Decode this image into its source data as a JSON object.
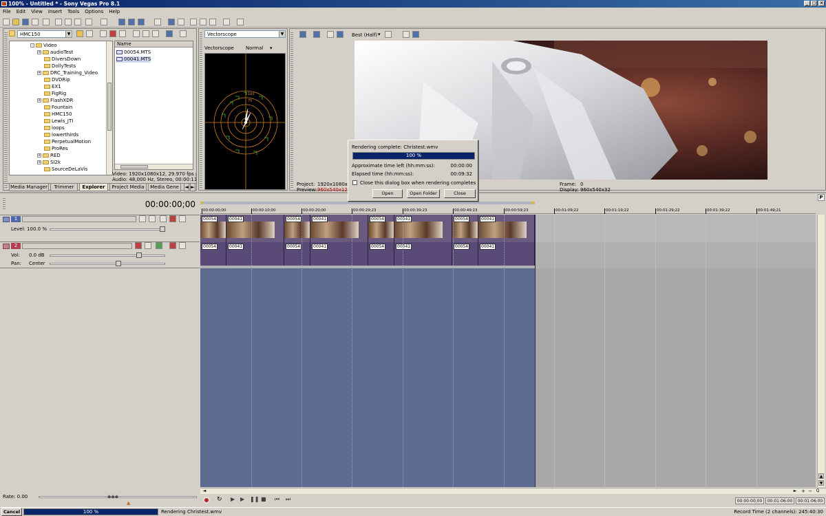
{
  "title": "100% - Untitled * - Sony Vegas Pro 8.1",
  "menu": [
    "File",
    "Edit",
    "View",
    "Insert",
    "Tools",
    "Options",
    "Help"
  ],
  "explorer": {
    "path": "HMC150",
    "tree": [
      {
        "label": "Video",
        "exp": "-"
      },
      {
        "label": "audioTest",
        "exp": "+"
      },
      {
        "label": "DiversDown",
        "exp": ""
      },
      {
        "label": "DollyTests",
        "exp": ""
      },
      {
        "label": "DRC_Training_Video",
        "exp": "+"
      },
      {
        "label": "DVDRip",
        "exp": ""
      },
      {
        "label": "EX1",
        "exp": ""
      },
      {
        "label": "FigRig",
        "exp": ""
      },
      {
        "label": "FlashXDR",
        "exp": "+"
      },
      {
        "label": "Fountain",
        "exp": ""
      },
      {
        "label": "HMC150",
        "exp": ""
      },
      {
        "label": "Lewis_JTI",
        "exp": ""
      },
      {
        "label": "loops",
        "exp": ""
      },
      {
        "label": "lowerthirds",
        "exp": ""
      },
      {
        "label": "PerpetualMotion",
        "exp": ""
      },
      {
        "label": "ProRes",
        "exp": ""
      },
      {
        "label": "RED",
        "exp": "+"
      },
      {
        "label": "SI2k",
        "exp": "+"
      },
      {
        "label": "SourceDeLaVis",
        "exp": ""
      }
    ],
    "list_header": "Name",
    "files": [
      "00054.MTS",
      "00041.MTS"
    ],
    "info_video": "Video: 1920x1080x12, 29.970 fps progr",
    "info_audio": "Audio: 48,000 Hz, Stereo, 00:00:11:12,",
    "tabs": [
      "Media Manager",
      "Trimmer",
      "Explorer",
      "Project Media",
      "Media Gene"
    ]
  },
  "scope": {
    "combo": "Vectorscope",
    "label": "Vectorscope",
    "mode": "Normal",
    "ring_labels": [
      "100",
      "75"
    ]
  },
  "preview": {
    "quality": "Best (Half)",
    "project_label": "Project:",
    "project_value": "1920x1080x12",
    "preview_label": "Preview:",
    "preview_value": "960x540x128,",
    "frame_label": "Frame:",
    "frame_value": "0",
    "display_label": "Display:",
    "display_value": "960x540x32"
  },
  "dialog": {
    "title": "Rendering complete: Christest.wmv",
    "progress": "100 %",
    "progress_value": 1.0,
    "time_left_label": "Approximate time left (hh:mm:ss):",
    "time_left": "00:00:00",
    "elapsed_label": "Elapsed time (hh:mm:ss):",
    "elapsed": "00:09:32",
    "close_label": "Close this dialog box when rendering completes",
    "buttons": [
      "Open",
      "Open Folder",
      "Close"
    ]
  },
  "timeline": {
    "timecode": "00:00:00;00",
    "ruler": [
      "00:00:00;00",
      "00:00:10;00",
      "00:00:20;00",
      "00:00:29;23",
      "00:00:39;23",
      "00:00:49;23",
      "00:00:59;23",
      "00:01:09;22",
      "00:01:19;22",
      "00:01:29;22",
      "00:01:39;22",
      "00:01:49;21"
    ],
    "video_track": {
      "num": "1",
      "level": "Level: 100.0 %"
    },
    "audio_track": {
      "num": "2",
      "vol_label": "Vol:",
      "vol": "0.0 dB",
      "pan_label": "Pan:",
      "pan": "Center"
    },
    "clips": [
      "00054",
      "00041",
      "00054",
      "00041",
      "00054",
      "00041",
      "00054",
      "00041"
    ],
    "rate": "Rate: 0.00",
    "tc_boxes": [
      "00:00:00;00",
      "00:01:06:00",
      "00:01:06:00"
    ]
  },
  "status": {
    "cancel": "Cancel",
    "progress": "100 %",
    "rendering": "Rendering Christest.wmv",
    "record": "Record Time (2 channels): 245:40:30"
  }
}
